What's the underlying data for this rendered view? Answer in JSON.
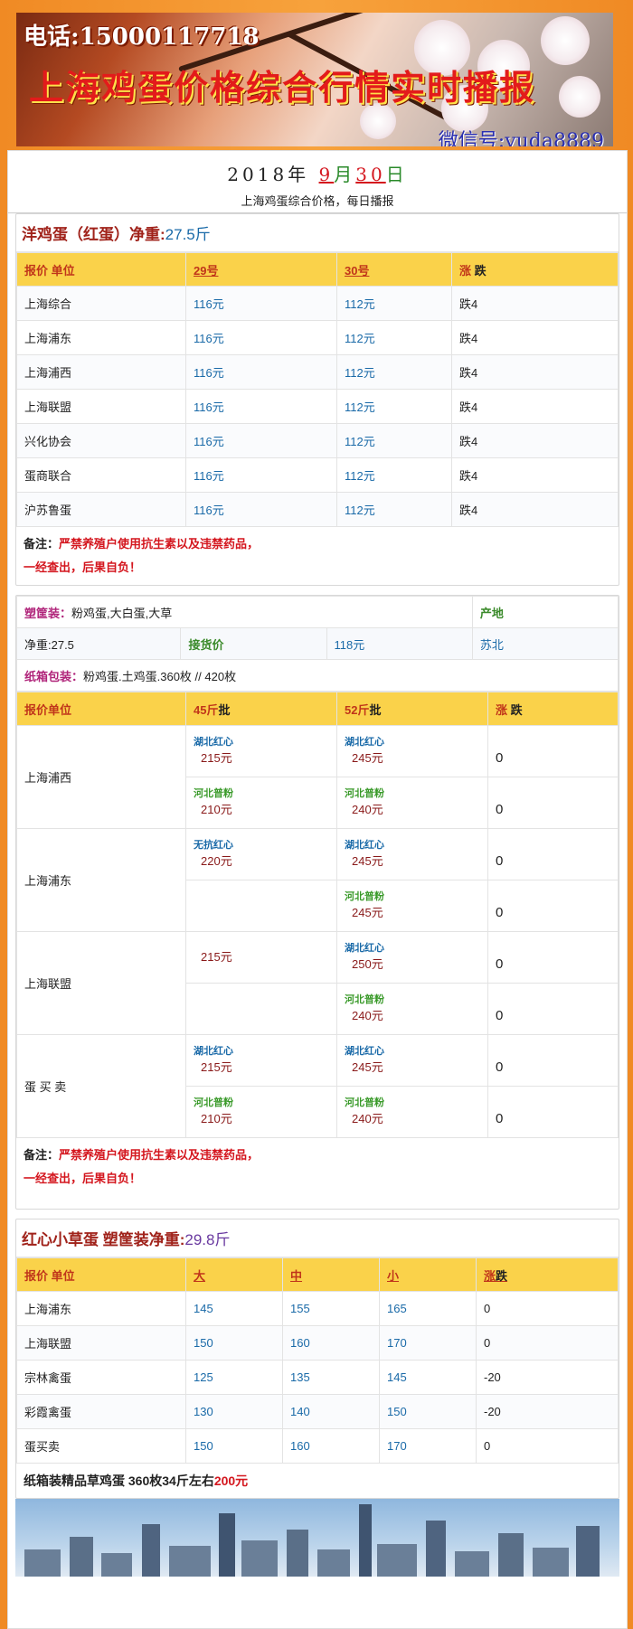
{
  "banner": {
    "phone": "电话:15000117718",
    "title": "上海鸡蛋价格综合行情实时播报",
    "wechat": "微信号:yuda8889"
  },
  "date": {
    "year": "2018",
    "year_unit": "年",
    "month": "9",
    "month_unit": "月",
    "day": "30",
    "day_unit": "日"
  },
  "subtitle": "上海鸡蛋综合价格，每日播报",
  "section1": {
    "title": "洋鸡蛋（红蛋）净重:",
    "weight": "27.5斤",
    "headers": [
      "报价 单位",
      "29号",
      "30号",
      "涨",
      "跌"
    ],
    "rows": [
      {
        "name": "上海综合",
        "d29": "116元",
        "d30": "112元",
        "chg": "跌4"
      },
      {
        "name": "上海浦东",
        "d29": "116元",
        "d30": "112元",
        "chg": "跌4"
      },
      {
        "name": "上海浦西",
        "d29": "116元",
        "d30": "112元",
        "chg": "跌4"
      },
      {
        "name": "上海联盟",
        "d29": "116元",
        "d30": "112元",
        "chg": "跌4"
      },
      {
        "name": "兴化协会",
        "d29": "116元",
        "d30": "112元",
        "chg": "跌4"
      },
      {
        "name": "蛋商联合",
        "d29": "116元",
        "d30": "112元",
        "chg": "跌4"
      },
      {
        "name": "沪苏鲁蛋",
        "d29": "116元",
        "d30": "112元",
        "chg": "跌4"
      }
    ],
    "note_label": "备注：",
    "note_line1": "严禁养殖户使用抗生素以及违禁药品，",
    "note_line2": "一经查出，后果自负！"
  },
  "section2": {
    "basket_label": "塑筐装：",
    "basket_text": "粉鸡蛋,大白蛋,大草",
    "origin_label": "产地",
    "weight_text": "净重:27.5",
    "receive_label": "接货价",
    "receive_price": "118元",
    "origin_value": "苏北",
    "carton_label": "纸箱包装：",
    "carton_text": "粉鸡蛋.土鸡蛋.360枚 // 420枚",
    "headers": {
      "unit": "报价单位",
      "c45": "45斤",
      "c45b": "批",
      "c52": "52斤",
      "c52b": "批",
      "up": "涨",
      "down": "跌"
    },
    "groups": [
      {
        "name": "上海浦西",
        "rows": [
          {
            "l45": "湖北红心",
            "p45": "215元",
            "l52": "湖北红心",
            "p52": "245元",
            "chg": "0"
          },
          {
            "l45": "河北普粉",
            "p45": "210元",
            "l52": "河北普粉",
            "p52": "240元",
            "chg": "0"
          }
        ]
      },
      {
        "name": "上海浦东",
        "rows": [
          {
            "l45": "无抗红心",
            "p45": "220元",
            "l52": "湖北红心",
            "p52": "245元",
            "chg": "0"
          },
          {
            "l45": "",
            "p45": "",
            "l52": "河北普粉",
            "p52": "245元",
            "chg": "0"
          }
        ]
      },
      {
        "name": "上海联盟",
        "rows": [
          {
            "l45": "",
            "p45": "215元",
            "l52": "湖北红心",
            "p52": "250元",
            "chg": "0"
          },
          {
            "l45": "",
            "p45": "",
            "l52": "河北普粉",
            "p52": "240元",
            "chg": "0"
          }
        ]
      },
      {
        "name": "蛋 买 卖",
        "rows": [
          {
            "l45": "湖北红心",
            "p45": "215元",
            "l52": "湖北红心",
            "p52": "245元",
            "chg": "0"
          },
          {
            "l45": "河北普粉",
            "p45": "210元",
            "l52": "河北普粉",
            "p52": "240元",
            "chg": "0"
          }
        ]
      }
    ],
    "note_label": "备注：",
    "note_line1": "严禁养殖户使用抗生素以及违禁药品，",
    "note_line2": "一经查出，后果自负！"
  },
  "section3": {
    "title": "红心小草蛋 塑筐装净重:",
    "weight": "29.8斤",
    "headers": [
      "报价 单位",
      "大",
      "中",
      "小",
      "涨",
      "跌"
    ],
    "rows": [
      {
        "name": "上海浦东",
        "big": "145",
        "mid": "155",
        "small": "165",
        "chg": "0"
      },
      {
        "name": "上海联盟",
        "big": "150",
        "mid": "160",
        "small": "170",
        "chg": "0"
      },
      {
        "name": "宗林禽蛋",
        "big": "125",
        "mid": "135",
        "small": "145",
        "chg": "-20"
      },
      {
        "name": "彩霞禽蛋",
        "big": "130",
        "mid": "140",
        "small": "150",
        "chg": "-20"
      },
      {
        "name": "蛋买卖",
        "big": "150",
        "mid": "160",
        "small": "170",
        "chg": "0"
      }
    ],
    "footer_text": "纸箱装精品草鸡蛋 360枚34斤左右",
    "footer_price": "200元"
  }
}
